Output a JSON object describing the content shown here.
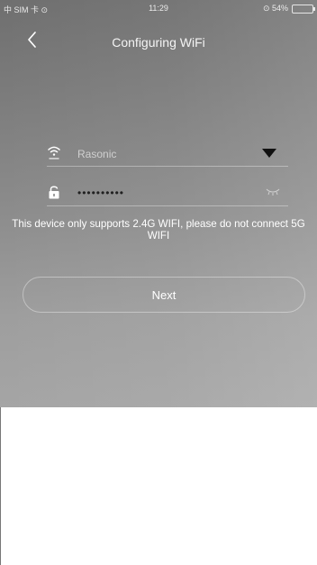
{
  "status_bar": {
    "left": "中 SIM 卡 ⊙",
    "time": "11:29",
    "battery": "⊙ 54%"
  },
  "header": {
    "title": "Configuring WiFi"
  },
  "form": {
    "ssid": "Rasonic",
    "password": "••••••••••"
  },
  "notice": "This device only supports 2.4G WIFI, please do not connect 5G WIFI",
  "buttons": {
    "next": "Next"
  },
  "colors": {
    "hero_gradient_top": "#6f6f6f",
    "hero_gradient_bottom": "#a5a5a5",
    "text_light": "#ffffff",
    "text_dark": "#202020"
  },
  "icons": {
    "back": "chevron-left-icon",
    "wifi": "wifi-icon",
    "lock": "lock-icon",
    "dropdown": "triangle-down-icon",
    "eye": "eye-closed-icon"
  }
}
